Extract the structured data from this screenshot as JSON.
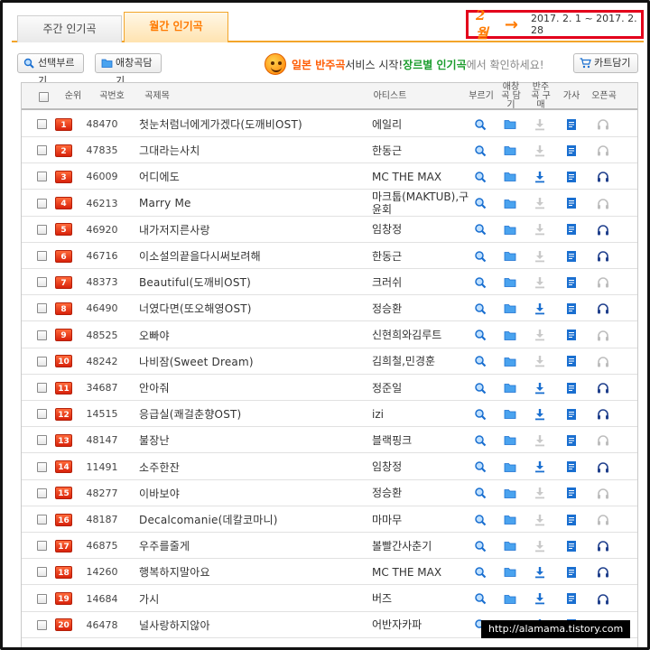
{
  "tabs": {
    "weekly": "주간 인기곡",
    "monthly": "월간 인기곡"
  },
  "period": {
    "month": "2월",
    "range": "2017. 2. 1 ~ 2017. 2. 28"
  },
  "toolbar": {
    "select_sing": "선택부르기",
    "favorites": "애창곡담기",
    "cart": "카트담기"
  },
  "promo": {
    "part1": "일본 반주곡",
    "part2": " 서비스 시작! ",
    "part3": "장르별 인기곡",
    "part4": "에서 확인하세요!"
  },
  "table": {
    "headers": {
      "rank": "순위",
      "number": "곡번호",
      "title": "곡제목",
      "artist": "아티스트",
      "sing": "부르기",
      "favorite": "애창곡 담기",
      "buy": "반주곡 구매",
      "lyrics": "가사",
      "ost": "오픈곡"
    },
    "rows": [
      {
        "rank": "1",
        "number": "48470",
        "title": "첫눈처럼너에게가겠다(도깨비OST)",
        "artist": "에일리",
        "buy": false,
        "ost": false
      },
      {
        "rank": "2",
        "number": "47835",
        "title": "그대라는사치",
        "artist": "한동근",
        "buy": false,
        "ost": false
      },
      {
        "rank": "3",
        "number": "46009",
        "title": "어디에도",
        "artist": "MC THE MAX",
        "buy": true,
        "ost": true
      },
      {
        "rank": "4",
        "number": "46213",
        "title": "Marry Me",
        "artist": "마크툽(MAKTUB),구윤회",
        "buy": false,
        "ost": false
      },
      {
        "rank": "5",
        "number": "46920",
        "title": "내가저지른사랑",
        "artist": "임창정",
        "buy": false,
        "ost": true
      },
      {
        "rank": "6",
        "number": "46716",
        "title": "이소설의끝을다시써보려해",
        "artist": "한동근",
        "buy": false,
        "ost": true
      },
      {
        "rank": "7",
        "number": "48373",
        "title": "Beautiful(도깨비OST)",
        "artist": "크러쉬",
        "buy": false,
        "ost": false
      },
      {
        "rank": "8",
        "number": "46490",
        "title": "너였다면(또오해영OST)",
        "artist": "정승환",
        "buy": true,
        "ost": true
      },
      {
        "rank": "9",
        "number": "48525",
        "title": "오빠야",
        "artist": "신현희와김루트",
        "buy": false,
        "ost": false
      },
      {
        "rank": "10",
        "number": "48242",
        "title": "나비잠(Sweet Dream)",
        "artist": "김희철,민경훈",
        "buy": false,
        "ost": false
      },
      {
        "rank": "11",
        "number": "34687",
        "title": "안아줘",
        "artist": "정준일",
        "buy": true,
        "ost": true
      },
      {
        "rank": "12",
        "number": "14515",
        "title": "응급실(쾌걸춘향OST)",
        "artist": "izi",
        "buy": true,
        "ost": true
      },
      {
        "rank": "13",
        "number": "48147",
        "title": "불장난",
        "artist": "블랙핑크",
        "buy": false,
        "ost": false
      },
      {
        "rank": "14",
        "number": "11491",
        "title": "소주한잔",
        "artist": "임창정",
        "buy": true,
        "ost": true
      },
      {
        "rank": "15",
        "number": "48277",
        "title": "이바보야",
        "artist": "정승환",
        "buy": false,
        "ost": false
      },
      {
        "rank": "16",
        "number": "48187",
        "title": "Decalcomanie(데칼코마니)",
        "artist": "마마무",
        "buy": false,
        "ost": false
      },
      {
        "rank": "17",
        "number": "46875",
        "title": "우주를줄게",
        "artist": "볼빨간사춘기",
        "buy": false,
        "ost": true
      },
      {
        "rank": "18",
        "number": "14260",
        "title": "행복하지말아요",
        "artist": "MC THE MAX",
        "buy": true,
        "ost": true
      },
      {
        "rank": "19",
        "number": "14684",
        "title": "가시",
        "artist": "버즈",
        "buy": true,
        "ost": true
      },
      {
        "rank": "20",
        "number": "46478",
        "title": "널사랑하지않아",
        "artist": "어반자카파",
        "buy": true,
        "ost": true
      }
    ]
  },
  "watermark": "http://alamama.tistory.com",
  "colors": {
    "accent_orange": "#ff7a00",
    "highlight_red": "#e3001b",
    "rank_badge": "#d8220b",
    "icon_blue": "#1a6fd0",
    "promo_green": "#1a9c2c"
  },
  "icons": {
    "sing": "search-mic-icon",
    "favorite": "folder-icon",
    "buy": "download-arrow-icon",
    "lyrics": "document-icon",
    "ost": "headphones-icon",
    "cart": "cart-icon"
  }
}
